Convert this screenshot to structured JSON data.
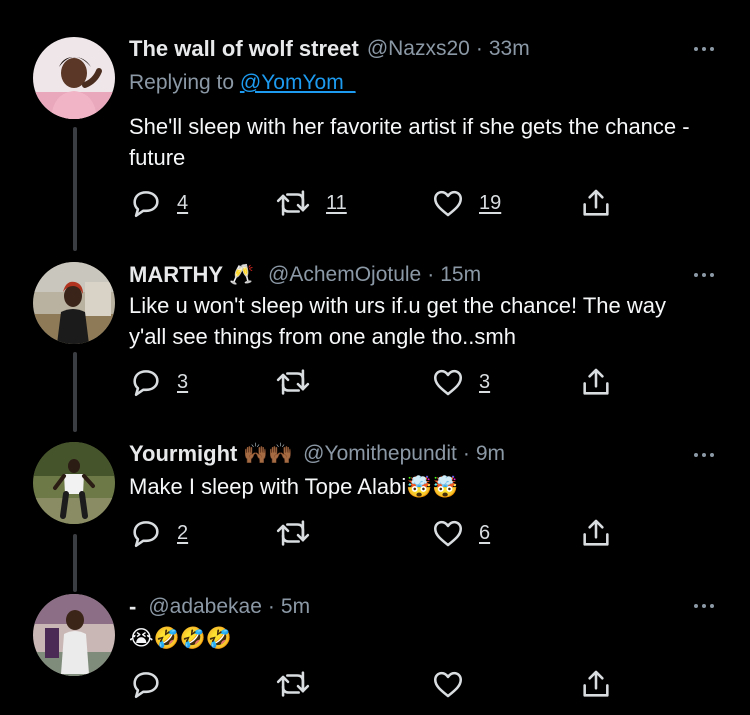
{
  "theme": {
    "background": "#000000",
    "text": "#e7e9ea",
    "muted": "#8b98a5",
    "link": "#1d9bf0",
    "thread_line": "#3a3d41"
  },
  "tweets": [
    {
      "display_name": "The wall of wolf street",
      "name_emoji": "",
      "handle": "@Nazxs20",
      "separator": "·",
      "time": "33m",
      "replying_prefix": "Replying to",
      "replying_to": "@YomYom_",
      "text": "She'll sleep with her favorite artist if she gets the chance - future",
      "trailing_emojis": "",
      "reply_count": "4",
      "retweet_count": "11",
      "like_count": "19",
      "more_icon": "more-dots-icon",
      "avatar_icon": "user-avatar"
    },
    {
      "display_name": "MARTHY",
      "name_emoji": "🥂",
      "handle": "@AchemOjotule",
      "separator": "·",
      "time": "15m",
      "text": "Like u won't sleep with urs if.u get the chance! The way y'all see things from one angle tho..smh",
      "trailing_emojis": "",
      "reply_count": "3",
      "retweet_count": "",
      "like_count": "3",
      "more_icon": "more-dots-icon",
      "avatar_icon": "user-avatar"
    },
    {
      "display_name": "Yourmight",
      "name_emoji": "🙌🏾🙌🏾",
      "handle": "@Yomithepundit",
      "separator": "·",
      "time": "9m",
      "text": "Make I sleep with Tope Alabi",
      "trailing_emojis": "🤯🤯",
      "reply_count": "2",
      "retweet_count": "",
      "like_count": "6",
      "more_icon": "more-dots-icon",
      "avatar_icon": "user-avatar"
    },
    {
      "display_name": "-",
      "name_emoji": "",
      "handle": "@adabekae",
      "separator": "·",
      "time": "5m",
      "text": "",
      "trailing_emojis": "😭🤣🤣🤣",
      "reply_count": "",
      "retweet_count": "",
      "like_count": "",
      "more_icon": "more-dots-icon",
      "avatar_icon": "user-avatar"
    }
  ]
}
